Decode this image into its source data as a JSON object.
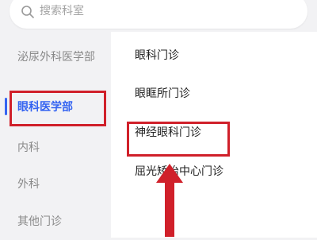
{
  "search": {
    "placeholder": "搜索科室"
  },
  "departments": [
    {
      "label": "泌尿外科医学部",
      "active": false
    },
    {
      "label": "眼科医学部",
      "active": true
    },
    {
      "label": "内科",
      "active": false
    },
    {
      "label": "外科",
      "active": false
    },
    {
      "label": "其他门诊",
      "active": false
    }
  ],
  "clinics": [
    {
      "label": "眼科门诊"
    },
    {
      "label": "眼眶所门诊"
    },
    {
      "label": "神经眼科门诊"
    },
    {
      "label": "屈光矫治中心门诊"
    }
  ],
  "colors": {
    "accent": "#3564f1",
    "highlight": "#d0202a",
    "sidebar_bg": "#f2f2f4"
  },
  "icons": {
    "search": "search-icon",
    "pointer": "arrow-up-icon"
  }
}
